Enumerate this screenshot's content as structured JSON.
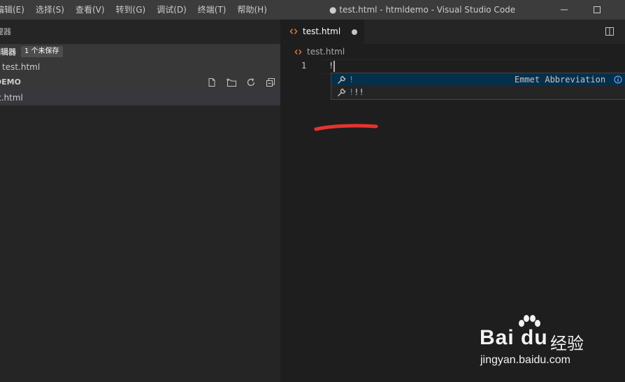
{
  "menu": {
    "items": [
      "编辑(E)",
      "选择(S)",
      "查看(V)",
      "转到(G)",
      "调试(D)",
      "终端(T)",
      "帮助(H)"
    ]
  },
  "window": {
    "title": "● test.html - htmldemo - Visual Studio Code"
  },
  "sidebar": {
    "title": "理器",
    "open_editors": {
      "title": "编辑器",
      "badge": "1 个未保存",
      "file": "test.html"
    },
    "folder": {
      "title": "DEMO",
      "file": "t.html"
    }
  },
  "editor": {
    "tab": {
      "label": "test.html"
    },
    "breadcrumb": "test.html",
    "line_number": "1",
    "code": "!"
  },
  "suggest": {
    "items": [
      {
        "match": "!",
        "rest": "",
        "detail": "Emmet Abbreviation"
      },
      {
        "match": "!",
        "rest": "!!"
      }
    ]
  },
  "watermark": {
    "brand": "Bai du",
    "text": "经验",
    "url": "jingyan.baidu.com"
  },
  "colors": {
    "accent_blue": "#18a3ff",
    "selection": "#062f4a",
    "html_icon": "#e37933",
    "annotation": "#e8322f"
  }
}
